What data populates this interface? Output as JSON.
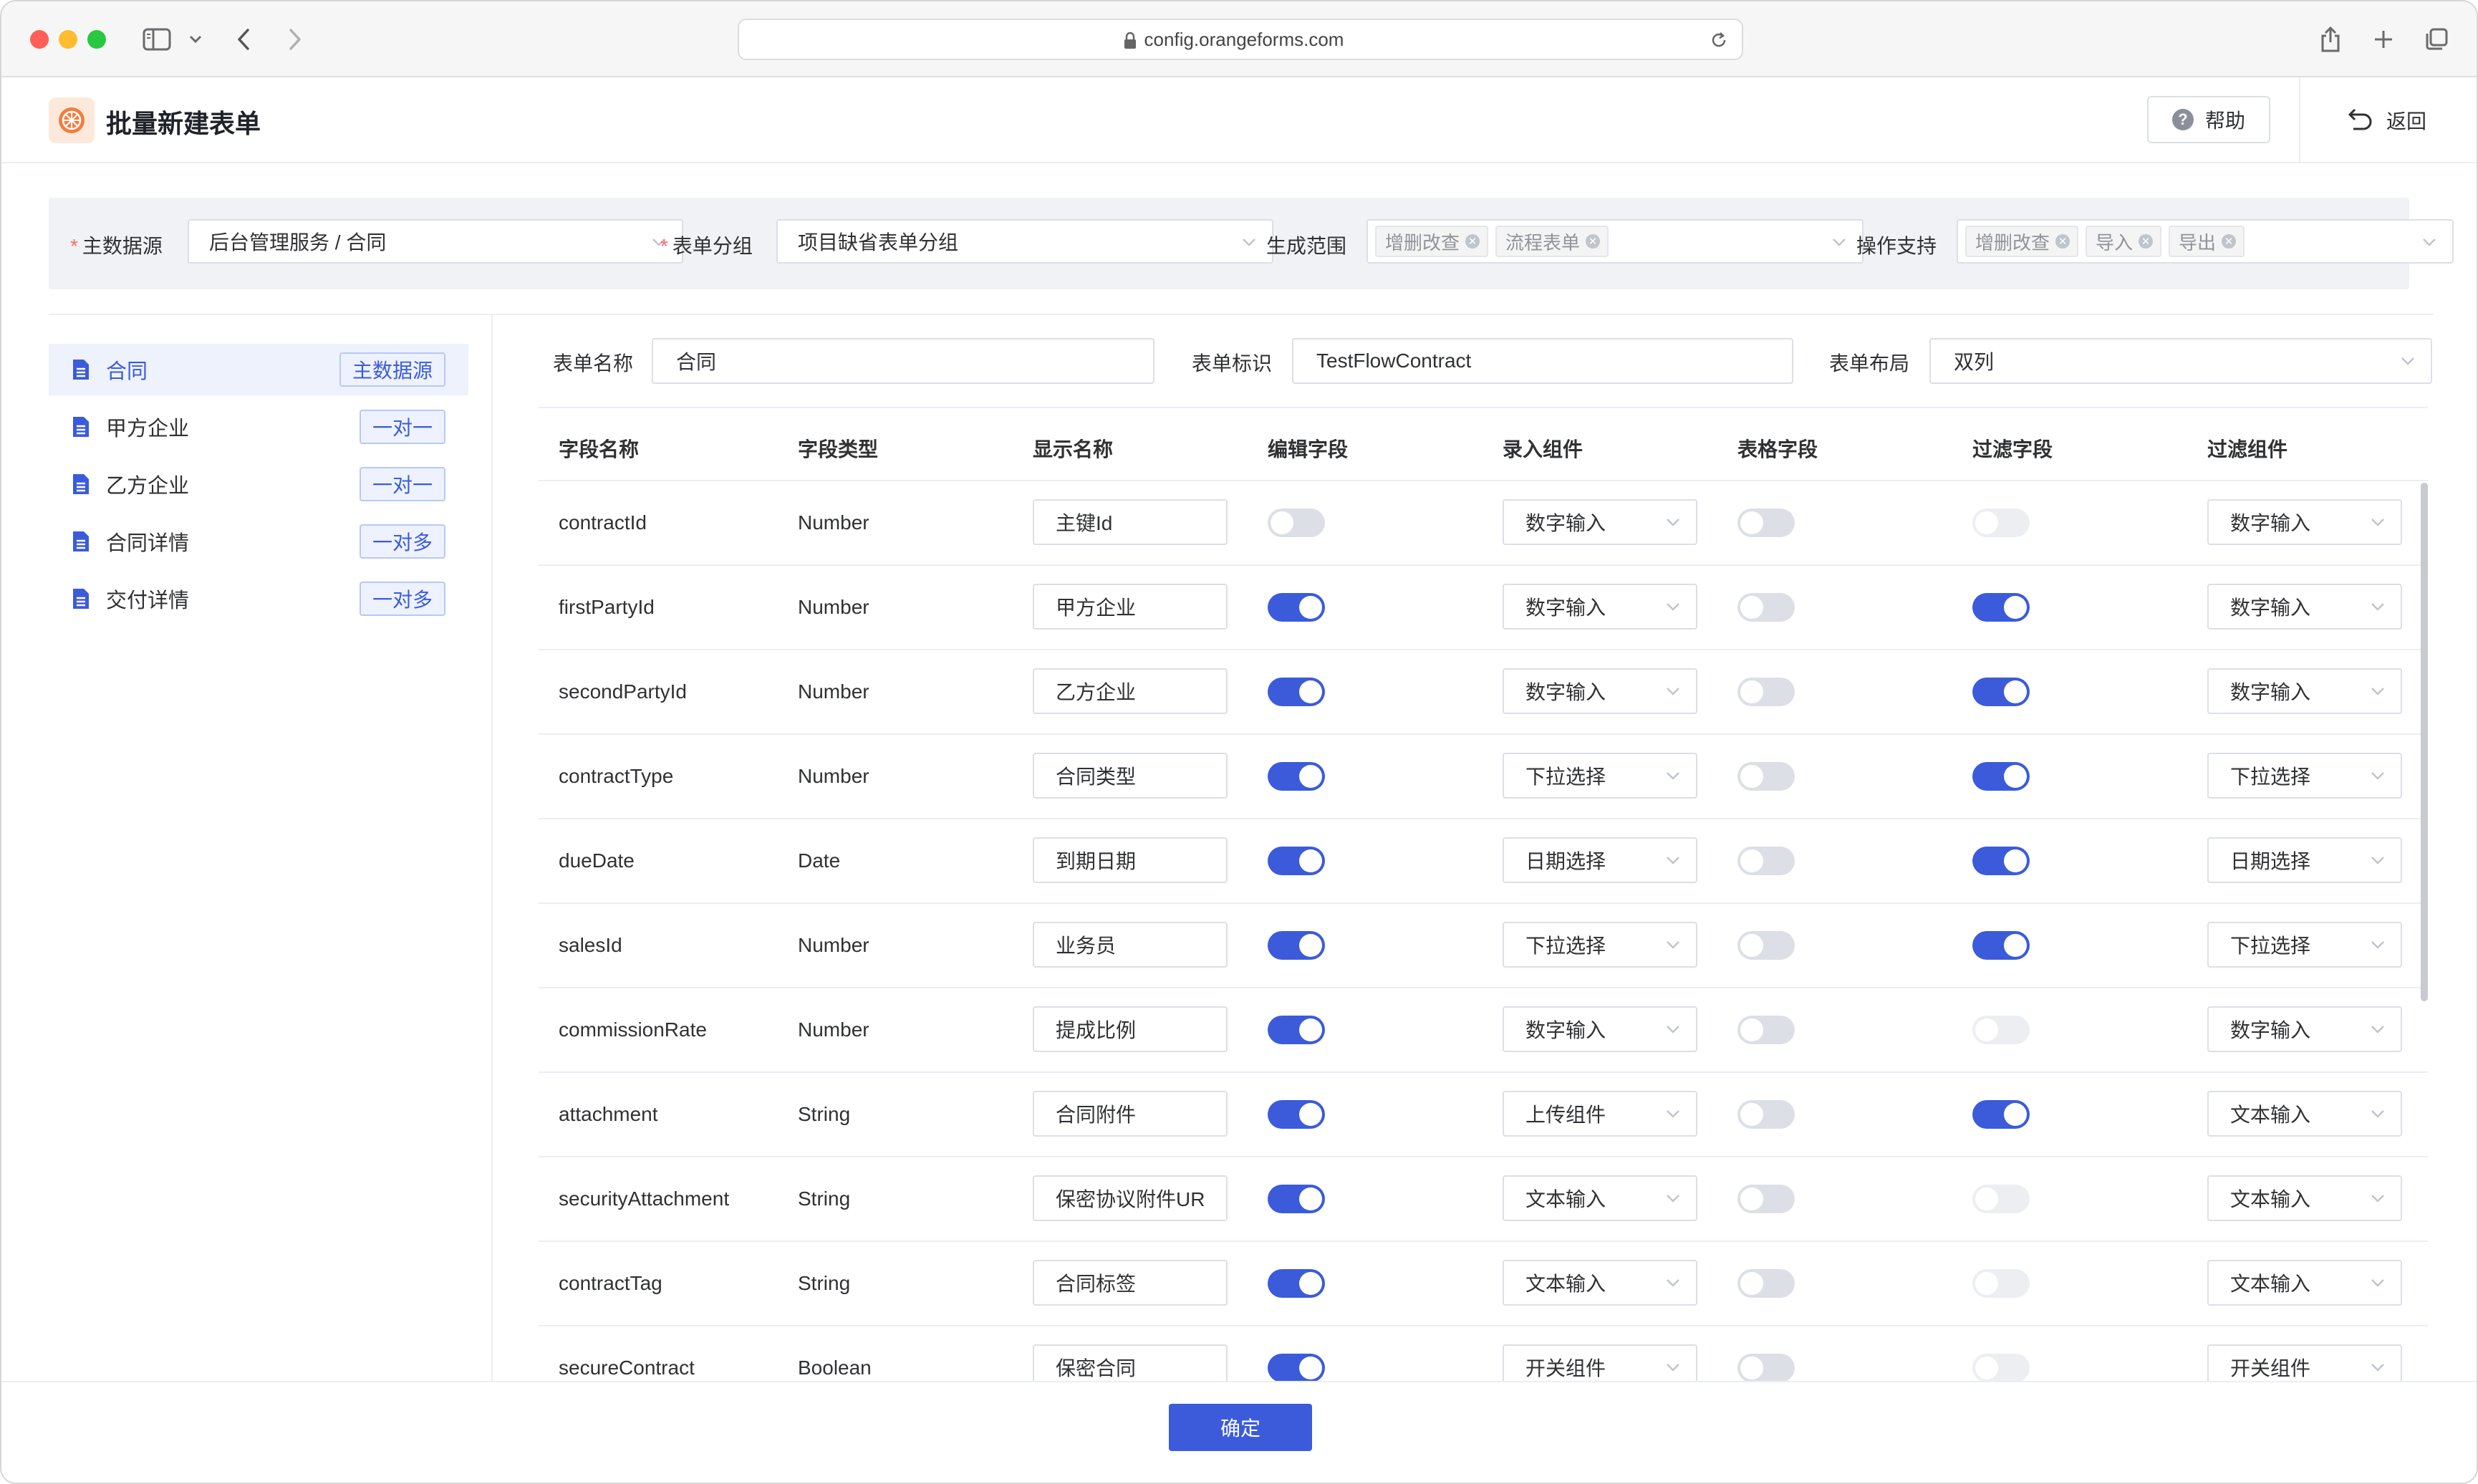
{
  "browser": {
    "url": "config.orangeforms.com"
  },
  "header": {
    "title": "批量新建表单",
    "help_label": "帮助",
    "back_label": "返回"
  },
  "filters": {
    "main_source": {
      "label": "主数据源",
      "value": "后台管理服务 / 合同"
    },
    "form_group": {
      "label": "表单分组",
      "value": "项目缺省表单分组"
    },
    "gen_scope": {
      "label": "生成范围",
      "tags": [
        "增删改查",
        "流程表单"
      ]
    },
    "ops_support": {
      "label": "操作支持",
      "tags": [
        "增删改查",
        "导入",
        "导出"
      ]
    }
  },
  "sidebar": {
    "items": [
      {
        "label": "合同",
        "badge": "主数据源",
        "active": true
      },
      {
        "label": "甲方企业",
        "badge": "一对一",
        "active": false
      },
      {
        "label": "乙方企业",
        "badge": "一对一",
        "active": false
      },
      {
        "label": "合同详情",
        "badge": "一对多",
        "active": false
      },
      {
        "label": "交付详情",
        "badge": "一对多",
        "active": false
      }
    ]
  },
  "form": {
    "name_label": "表单名称",
    "name_value": "合同",
    "id_label": "表单标识",
    "id_value": "TestFlowContract",
    "layout_label": "表单布局",
    "layout_value": "双列"
  },
  "table": {
    "columns": [
      "字段名称",
      "字段类型",
      "显示名称",
      "编辑字段",
      "录入组件",
      "表格字段",
      "过滤字段",
      "过滤组件"
    ],
    "rows": [
      {
        "field": "contractId",
        "type": "Number",
        "display": "主键Id",
        "edit": "off",
        "input": "数字输入",
        "grid": "off",
        "filter": "disabled",
        "filter_comp": "数字输入"
      },
      {
        "field": "firstPartyId",
        "type": "Number",
        "display": "甲方企业",
        "edit": "on",
        "input": "数字输入",
        "grid": "off",
        "filter": "on",
        "filter_comp": "数字输入"
      },
      {
        "field": "secondPartyId",
        "type": "Number",
        "display": "乙方企业",
        "edit": "on",
        "input": "数字输入",
        "grid": "off",
        "filter": "on",
        "filter_comp": "数字输入"
      },
      {
        "field": "contractType",
        "type": "Number",
        "display": "合同类型",
        "edit": "on",
        "input": "下拉选择",
        "grid": "off",
        "filter": "on",
        "filter_comp": "下拉选择"
      },
      {
        "field": "dueDate",
        "type": "Date",
        "display": "到期日期",
        "edit": "on",
        "input": "日期选择",
        "grid": "off",
        "filter": "on",
        "filter_comp": "日期选择"
      },
      {
        "field": "salesId",
        "type": "Number",
        "display": "业务员",
        "edit": "on",
        "input": "下拉选择",
        "grid": "off",
        "filter": "on",
        "filter_comp": "下拉选择"
      },
      {
        "field": "commissionRate",
        "type": "Number",
        "display": "提成比例",
        "edit": "on",
        "input": "数字输入",
        "grid": "off",
        "filter": "disabled",
        "filter_comp": "数字输入"
      },
      {
        "field": "attachment",
        "type": "String",
        "display": "合同附件",
        "edit": "on",
        "input": "上传组件",
        "grid": "off",
        "filter": "on",
        "filter_comp": "文本输入"
      },
      {
        "field": "securityAttachment",
        "type": "String",
        "display": "保密协议附件UR",
        "edit": "on",
        "input": "文本输入",
        "grid": "off",
        "filter": "disabled",
        "filter_comp": "文本输入"
      },
      {
        "field": "contractTag",
        "type": "String",
        "display": "合同标签",
        "edit": "on",
        "input": "文本输入",
        "grid": "off",
        "filter": "disabled",
        "filter_comp": "文本输入"
      },
      {
        "field": "secureContract",
        "type": "Boolean",
        "display": "保密合同",
        "edit": "on",
        "input": "开关组件",
        "grid": "off",
        "filter": "disabled",
        "filter_comp": "开关组件"
      }
    ]
  },
  "footer": {
    "confirm_label": "确定"
  },
  "colors": {
    "primary": "#3b5bdb",
    "required": "#f56c6c",
    "switch_off": "#dcdfe6"
  }
}
